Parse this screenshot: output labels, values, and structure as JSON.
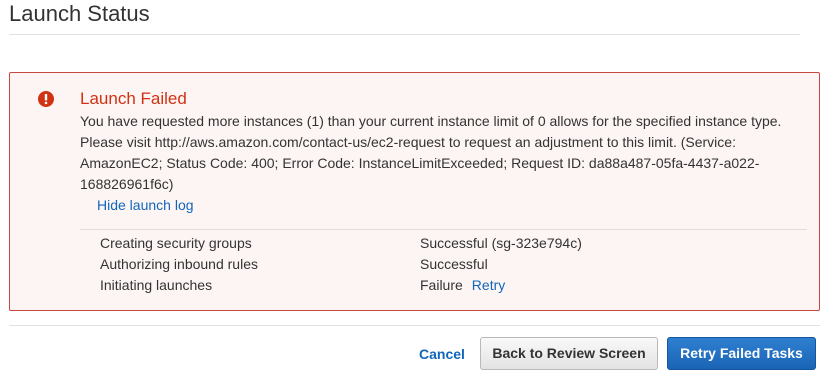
{
  "page": {
    "title": "Launch Status"
  },
  "error": {
    "icon": "exclamation-circle-icon",
    "title": "Launch Failed",
    "message": "You have requested more instances (1) than your current instance limit of 0 allows for the specified instance type. Please visit http://aws.amazon.com/contact-us/ec2-request to request an adjustment to this limit. (Service: AmazonEC2; Status Code: 400; Error Code: InstanceLimitExceeded; Request ID: da88a487-05fa-4437-a022-168826961f6c)",
    "hide_log_label": "Hide launch log",
    "color": "#d13212"
  },
  "launch_log": [
    {
      "task": "Creating security groups",
      "status": "Successful (sg-323e794c)",
      "action": ""
    },
    {
      "task": "Authorizing inbound rules",
      "status": "Successful",
      "action": ""
    },
    {
      "task": "Initiating launches",
      "status": "Failure",
      "action": "Retry"
    }
  ],
  "footer": {
    "cancel_label": "Cancel",
    "back_label": "Back to Review Screen",
    "retry_label": "Retry Failed Tasks",
    "accent_color": "#1166bb"
  }
}
